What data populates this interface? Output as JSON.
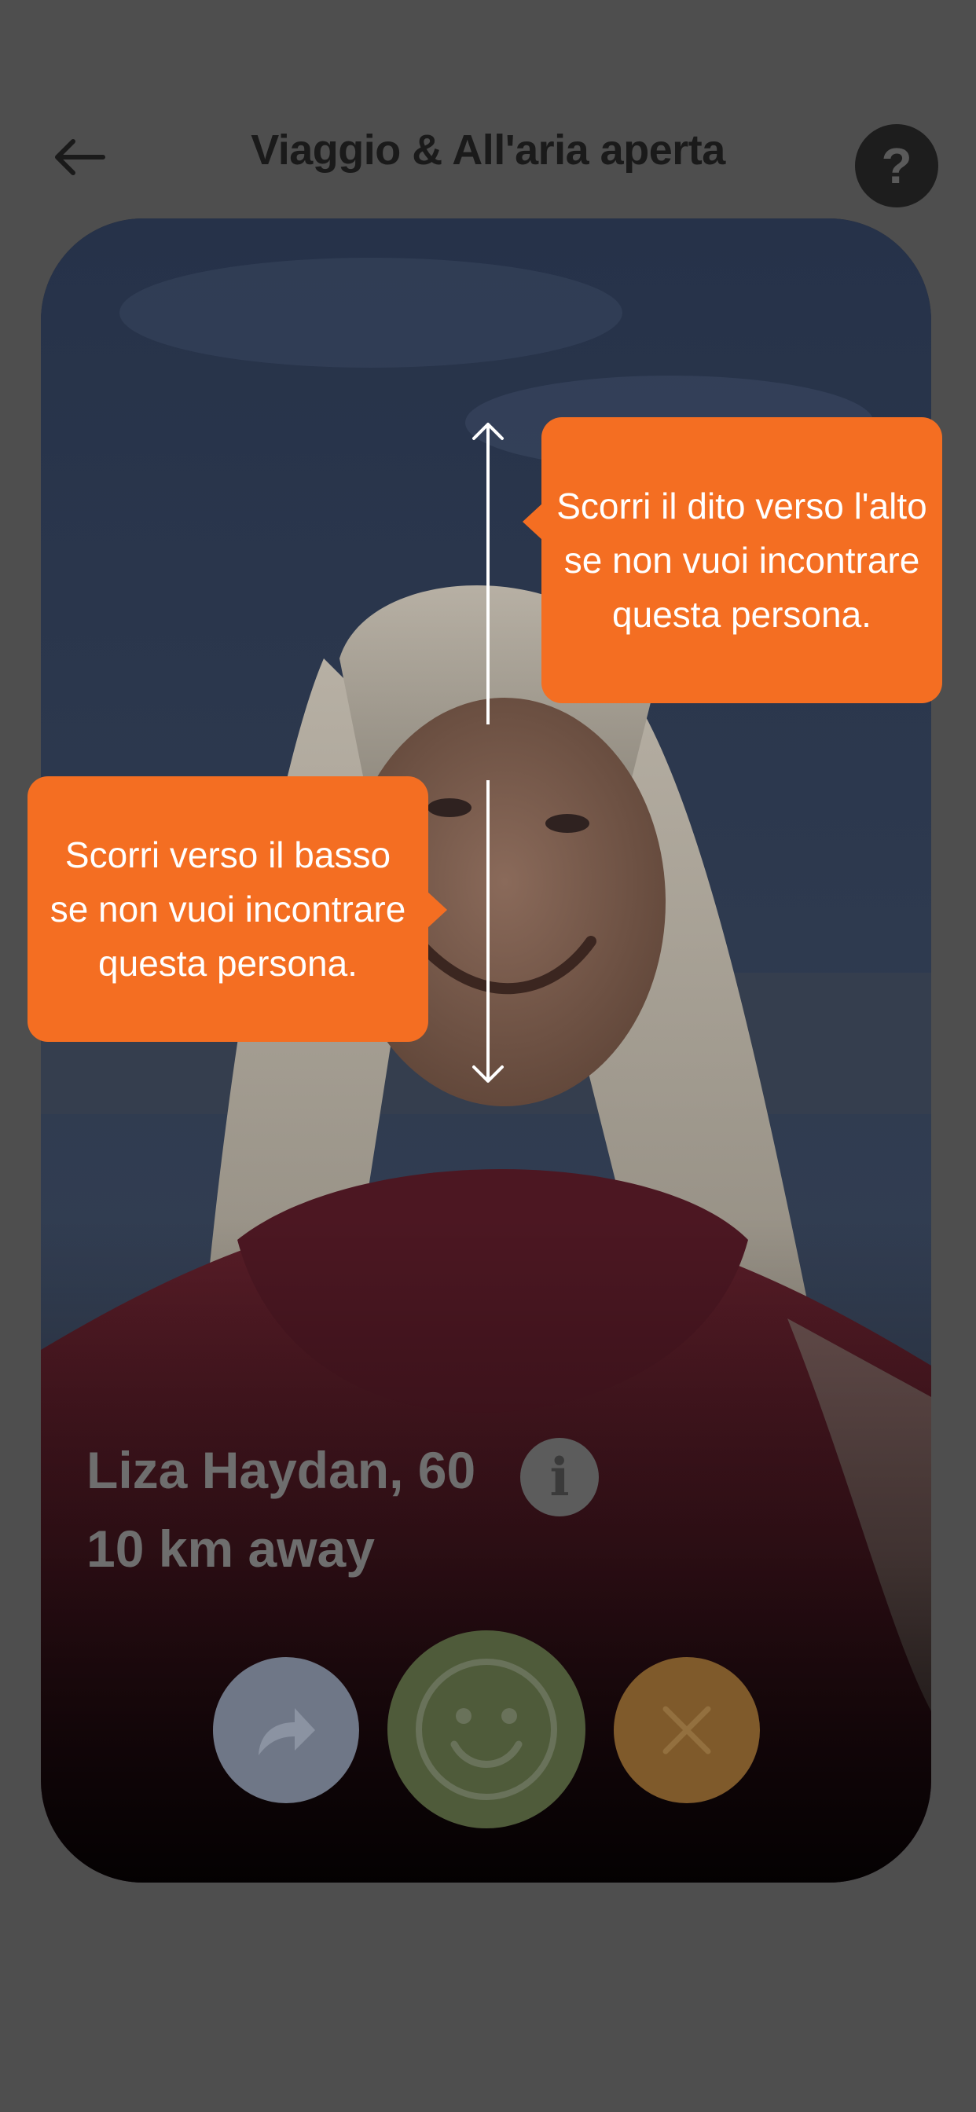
{
  "header": {
    "title": "Viaggio & All'aria aperta",
    "back_icon": "arrow-left-icon",
    "help_icon": "question-mark-icon",
    "help_label": "?"
  },
  "profile": {
    "name_age": "Liza Haydan, 60",
    "distance": "10 km away",
    "info_label": "i",
    "info_icon": "info-icon"
  },
  "actions": {
    "share_icon": "share-arrow-icon",
    "like_icon": "smiley-face-icon",
    "pass_icon": "close-x-icon"
  },
  "onboarding": {
    "swipe_up_hint": "Scorri il dito verso l'alto se non vuoi incontrare questa persona.",
    "swipe_down_hint": "Scorri verso il basso se non vuoi incontrare questa persona."
  },
  "colors": {
    "tooltip": "#f46e22",
    "overlay": "#4e4e4e",
    "share_button": "#6f7787",
    "like_button": "#4f5b3a",
    "pass_button": "#7f5a2b"
  }
}
